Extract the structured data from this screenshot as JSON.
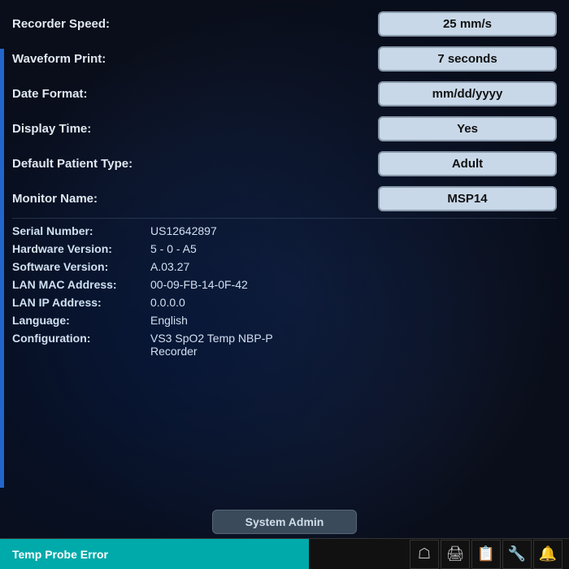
{
  "header": {
    "recorder_speed_label": "Recorder Speed:",
    "recorder_speed_value": "25 mm/s"
  },
  "settings": [
    {
      "label": "Waveform Print:",
      "value": "7 seconds",
      "type": "box"
    },
    {
      "label": "Date Format:",
      "value": "mm/dd/yyyy",
      "type": "box"
    },
    {
      "label": "Display Time:",
      "value": "Yes",
      "type": "box"
    },
    {
      "label": "Default Patient Type:",
      "value": "Adult",
      "type": "box"
    },
    {
      "label": "Monitor Name:",
      "value": "MSP14",
      "type": "box"
    }
  ],
  "info": [
    {
      "label": "Serial Number:",
      "value": "US12642897"
    },
    {
      "label": "Hardware Version:",
      "value": "5 - 0 - A5"
    },
    {
      "label": "Software Version:",
      "value": "A.03.27"
    },
    {
      "label": "LAN MAC Address:",
      "value": "00-09-FB-14-0F-42"
    },
    {
      "label": "LAN IP Address:",
      "value": "0.0.0.0"
    },
    {
      "label": "Language:",
      "value": "English"
    },
    {
      "label": "Configuration:",
      "value": "VS3 SpO2 Temp NBP-P",
      "value2": "Recorder"
    }
  ],
  "admin": {
    "button_label": "System Admin"
  },
  "statusbar": {
    "alert_text": "Temp Probe Error"
  },
  "icons": [
    "👤",
    "🖨",
    "📋",
    "🔧",
    "🔔"
  ]
}
